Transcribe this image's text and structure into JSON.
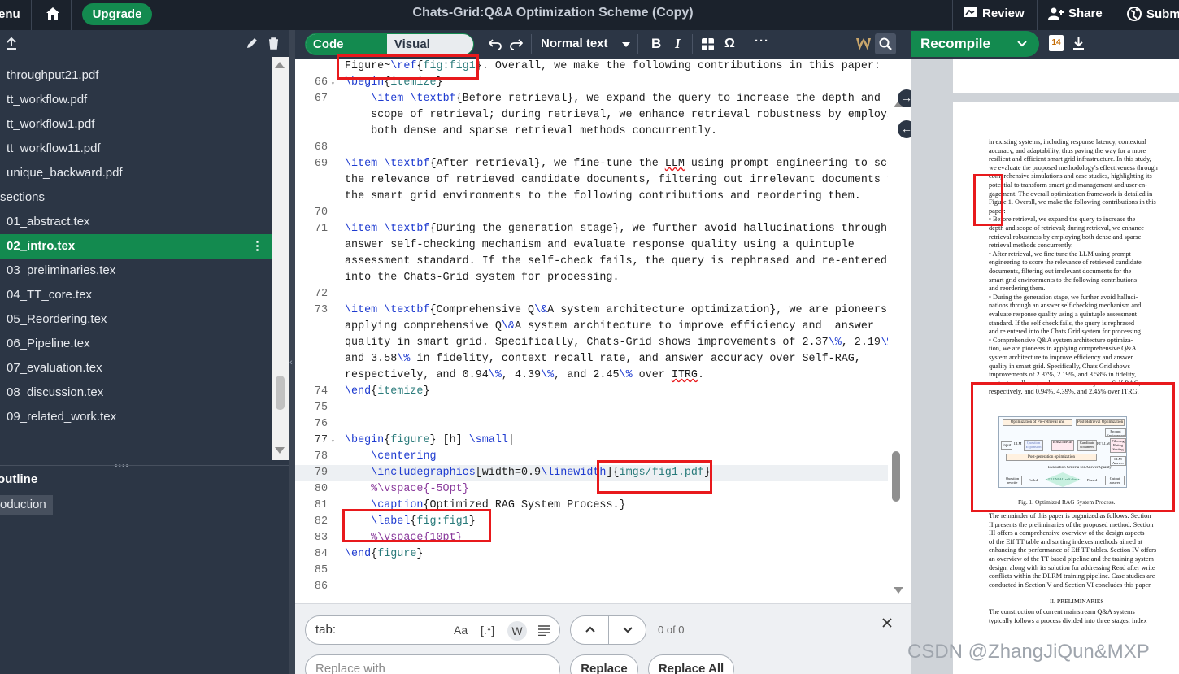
{
  "topbar": {
    "menu": "enu",
    "upgrade": "Upgrade",
    "title": "Chats-Grid:Q&A Optimization Scheme (Copy)",
    "review": "Review",
    "share": "Share",
    "submit": "Subm"
  },
  "files": [
    {
      "name": "throughput21.pdf",
      "selected": false
    },
    {
      "name": "tt_workflow.pdf",
      "selected": false
    },
    {
      "name": "tt_workflow1.pdf",
      "selected": false
    },
    {
      "name": "tt_workflow11.pdf",
      "selected": false
    },
    {
      "name": "unique_backward.pdf",
      "selected": false
    },
    {
      "name": "sections",
      "folder": true
    },
    {
      "name": "01_abstract.tex",
      "selected": false
    },
    {
      "name": "02_intro.tex",
      "selected": true
    },
    {
      "name": "03_preliminaries.tex",
      "selected": false
    },
    {
      "name": "04_TT_core.tex",
      "selected": false
    },
    {
      "name": "05_Reordering.tex",
      "selected": false
    },
    {
      "name": "06_Pipeline.tex",
      "selected": false
    },
    {
      "name": "07_evaluation.tex",
      "selected": false
    },
    {
      "name": "08_discussion.tex",
      "selected": false
    },
    {
      "name": "09_related_work.tex",
      "selected": false
    }
  ],
  "outline": {
    "header": "outline",
    "item": "oduction"
  },
  "editor": {
    "code_editor": "Code Editor",
    "visual_editor": "Visual Editor",
    "style": "Normal text",
    "bold": "B",
    "italic": "I",
    "omega": "Ω",
    "more": "···"
  },
  "code_lines": [
    {
      "n": "",
      "html": "Figure~<span class='cmd'>\\ref</span>{<span class='arg'>fig:fig1</span>}. Overall, we make the following contributions in this paper:"
    },
    {
      "n": "66",
      "html": "<span class='cmd'>\\begin</span>{<span class='arg'>itemize</span>}"
    },
    {
      "n": "67",
      "html": "    <span class='cmd'>\\item</span> <span class='cmd'>\\textbf</span>{Before retrieval}, we expand the query to increase the depth and"
    },
    {
      "n": "",
      "html": "    scope of retrieval; during retrieval, we enhance retrieval robustness by employing"
    },
    {
      "n": "",
      "html": "    both dense and sparse retrieval methods concurrently."
    },
    {
      "n": "68",
      "html": ""
    },
    {
      "n": "69",
      "html": "<span class='cmd'>\\item</span> <span class='cmd'>\\textbf</span>{After retrieval}, we fine-tune the <span style='text-decoration:underline wavy #e8191c'>LLM</span> using prompt engineering to score"
    },
    {
      "n": "",
      "html": "the relevance of retrieved candidate documents, filtering out irrelevant documents for"
    },
    {
      "n": "",
      "html": "the smart grid environments to the following contributions and reordering them."
    },
    {
      "n": "70",
      "html": ""
    },
    {
      "n": "71",
      "html": "<span class='cmd'>\\item</span> <span class='cmd'>\\textbf</span>{During the generation stage}, we further avoid hallucinations through an"
    },
    {
      "n": "",
      "html": "answer self-checking mechanism and evaluate response quality using a quintuple"
    },
    {
      "n": "",
      "html": "assessment standard. If the self-check fails, the query is rephrased and re-entered"
    },
    {
      "n": "",
      "html": "into the Chats-Grid system for processing."
    },
    {
      "n": "72",
      "html": ""
    },
    {
      "n": "73",
      "html": "<span class='cmd'>\\item</span> <span class='cmd'>\\textbf</span>{Comprehensive Q<span class='cmd'>\\&amp;</span>A system architecture optimization}, we are pioneers in"
    },
    {
      "n": "",
      "html": "applying comprehensive Q<span class='cmd'>\\&amp;</span>A system architecture to improve efficiency and  answer"
    },
    {
      "n": "",
      "html": "quality in smart grid. Specifically, Chats-Grid shows improvements of 2.37<span class='cmd'>\\%</span>, 2.19<span class='cmd'>\\%</span>,"
    },
    {
      "n": "",
      "html": "and 3.58<span class='cmd'>\\%</span> in fidelity, context recall rate, and answer accuracy over Self-RAG,"
    },
    {
      "n": "",
      "html": "respectively, and 0.94<span class='cmd'>\\%</span>, 4.39<span class='cmd'>\\%</span>, and 2.45<span class='cmd'>\\%</span> over <span style='text-decoration:underline wavy #e8191c'>ITRG</span>."
    },
    {
      "n": "74",
      "html": "<span class='cmd'>\\end</span>{<span class='arg'>itemize</span>}"
    },
    {
      "n": "75",
      "html": ""
    },
    {
      "n": "76",
      "html": ""
    },
    {
      "n": "77",
      "html": "<span class='cmd'>\\begin</span>{<span class='arg'>figure</span>} [h] <span class='cmd'>\\small</span>|"
    },
    {
      "n": "78",
      "html": "    <span class='cmd'>\\centering</span>"
    },
    {
      "n": "79",
      "html": "    <span class='cmd'>\\includegraphics</span>[width=0.9<span class='cmd'>\\linewidth</span>]{<span class='arg'>imgs/fig1.pdf</span>}"
    },
    {
      "n": "80",
      "html": "    <span class='cmt'>%\\vspace{-5Opt}</span>"
    },
    {
      "n": "81",
      "html": "    <span class='cmd'>\\caption</span>{Optimized RAG System Process.}"
    },
    {
      "n": "82",
      "html": "    <span class='cmd'>\\label</span>{<span class='arg'>fig:fig1</span>}"
    },
    {
      "n": "83",
      "html": "    <span class='cmt'>%\\vspace{10pt}</span>"
    },
    {
      "n": "84",
      "html": "<span class='cmd'>\\end</span>{<span class='arg'>figure</span>}"
    },
    {
      "n": "85",
      "html": ""
    },
    {
      "n": "86",
      "html": ""
    }
  ],
  "find": {
    "search_value": "tab:",
    "replace_placeholder": "Replace with",
    "match_case": "Aa",
    "regex": "[.*]",
    "whole_word": "W",
    "count": "0 of 0",
    "replace": "Replace",
    "replace_all": "Replace All"
  },
  "pdf": {
    "recompile": "Recompile",
    "badge": "14",
    "lines": [
      "in existing systems, including response latency, contextual",
      "accuracy, and adaptability, thus paving the way for a more",
      "resilient and efficient smart grid infrastructure. In this study,",
      "we evaluate the proposed methodology's effectiveness through",
      "comprehensive simulations and case studies, highlighting its",
      "potential to transform smart grid management and user en-",
      "gagement. The overall optimization framework is detailed in",
      "Figure 1. Overall, we make the following contributions in this",
      "paper:",
      "• Before retrieval, we expand the query to increase the",
      "  depth and scope of retrieval; during retrieval, we enhance",
      "  retrieval robustness by employing both dense and sparse",
      "  retrieval methods concurrently.",
      "• After retrieval, we fine tune the LLM using prompt",
      "  engineering to score the relevance of retrieved candidate",
      "  documents, filtering out irrelevant documents for the",
      "  smart grid environments to the following contributions",
      "  and reordering them.",
      "• During the generation stage, we further avoid halluci-",
      "  nations through an answer self checking mechanism and",
      "  evaluate response quality using a quintuple assessment",
      "  standard. If the self check fails, the query is rephrased",
      "  and re entered into the Chats Grid system for processing.",
      "• Comprehensive Q&A system architecture optimiza-",
      "  tion, we are pioneers in applying comprehensive Q&A",
      "  system architecture to improve efficiency and answer",
      "  quality in smart grid. Specifically, Chats Grid shows",
      "  improvements of 2.37%, 2.19%, and 3.58% in fidelity,",
      "  context recall rate, and answer accuracy over Self RAG,",
      "  respectively, and 0.94%, 4.39%, and 2.45% over ITRG."
    ],
    "fig_caption": "Fig. 1.  Optimized RAG System Process.",
    "fig_labels": {
      "pre": "Optimization of Pre-retrieval and Retrieval Stages",
      "post": "Post-Retrieval Optimization",
      "prompt": "Prompt Engineering",
      "bm25": "BM25 BGE",
      "cand": "Candidate document",
      "ft": "FT LLM",
      "filter": "Filtering Rating Sorting",
      "input": "Input",
      "llm": "LLM",
      "qexp": "Question Expansion",
      "postgen": "Post-generation optimization",
      "eval": "Evaluation Criteria for Answer Quality",
      "llmans": "LLM Answer",
      "qrew": "Question rewrite",
      "failed": "Failed",
      "passed": "Passed",
      "output": "Output answer",
      "judge": "FT LLM AL self check"
    },
    "lines2": [
      "The remainder of this paper is organized as follows. Section",
      "II presents the preliminaries of the proposed method. Section",
      "III offers a comprehensive overview of the design aspects",
      "of the Eff TT table and sorting indexes methods aimed at",
      "enhancing the performance of Eff TT tables. Section IV offers",
      "an overview of the TT based pipeline and the training system",
      "design, along with its solution for addressing Read after write",
      "conflicts within the DLRM training pipeline. Case studies are",
      "conducted in Section V and Section VI concludes this paper."
    ],
    "section": "II.  PRELIMINARIES",
    "lines3": [
      "The construction of current mainstream Q&A systems",
      "typically follows a process divided into three stages: index"
    ]
  },
  "watermark": "CSDN @ZhangJiQun&MXP",
  "colors": {
    "accent": "#138a4f",
    "dark": "#2c3645",
    "highlight": "#e8191c"
  }
}
